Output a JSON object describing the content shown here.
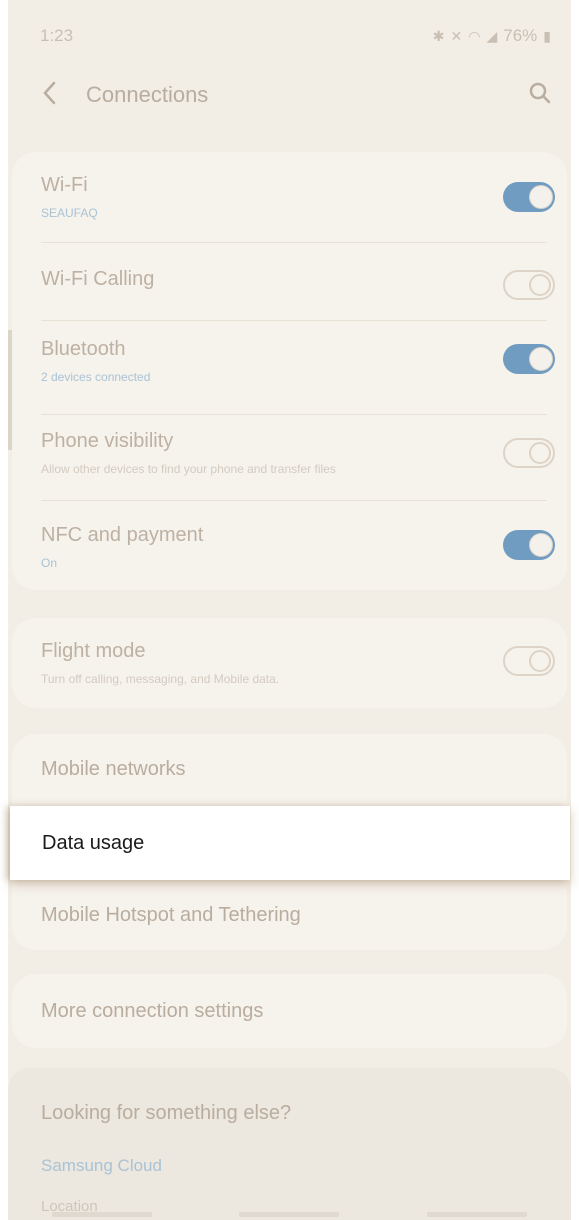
{
  "status_bar": {
    "time": "1:23",
    "icons": [
      "bluetooth-icon",
      "mute-icon",
      "wifi-icon",
      "signal-icon"
    ],
    "battery": "76%"
  },
  "header": {
    "title": "Connections",
    "back_icon": "chevron-left-icon",
    "search_icon": "search-icon"
  },
  "settings": [
    {
      "label": "Wi-Fi",
      "sub": "SEAUFAQ",
      "toggle": true
    },
    {
      "label": "Wi-Fi Calling",
      "sub": "",
      "toggle": false
    },
    {
      "label": "Bluetooth",
      "sub": "2 devices connected",
      "toggle": true
    },
    {
      "label": "Phone visibility",
      "sub": "Allow other devices to find your phone and transfer files",
      "toggle": false
    },
    {
      "label": "NFC and payment",
      "sub": "On",
      "toggle": true
    }
  ],
  "flight_mode": {
    "label": "Flight mode",
    "sub": "Turn off calling, messaging, and Mobile data.",
    "toggle": false
  },
  "menu": {
    "mobile_networks": "Mobile networks",
    "data_usage": "Data usage",
    "hotspot": "Mobile Hotspot and Tethering",
    "more": "More connection settings"
  },
  "looking": {
    "title": "Looking for something else?",
    "link": "Samsung Cloud",
    "cut": "Location"
  },
  "colors": {
    "toggle_on": "#6f9cc0",
    "background": "#f2ede5",
    "highlight": "#ffffff"
  }
}
